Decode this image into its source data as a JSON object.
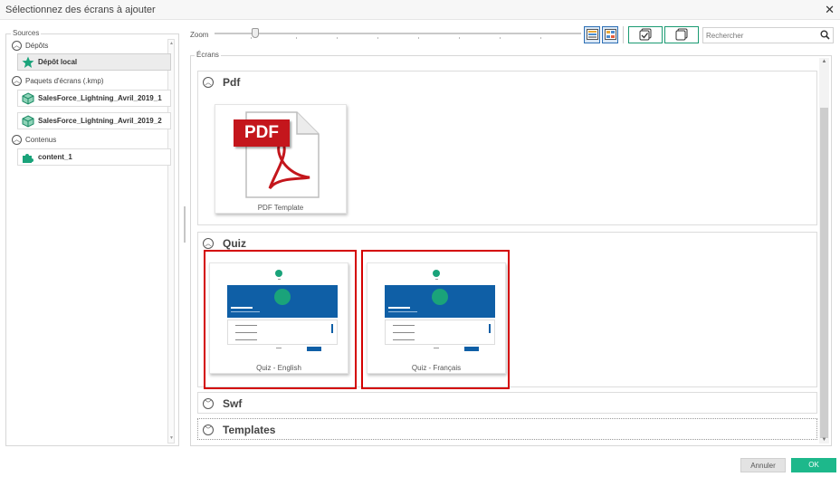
{
  "window": {
    "title": "Sélectionnez des écrans à ajouter",
    "close_icon": "close-icon"
  },
  "sources": {
    "legend": "Sources",
    "groups": [
      {
        "label": "Dépôts",
        "items": [
          {
            "label": "Dépôt local",
            "icon": "star-icon",
            "selected": true
          }
        ]
      },
      {
        "label": "Paquets d'écrans (.kmp)",
        "items": [
          {
            "label": "SalesForce_Lightning_Avril_2019_1",
            "icon": "package-icon"
          },
          {
            "label": "SalesForce_Lightning_Avril_2019_2",
            "icon": "package-icon"
          }
        ]
      },
      {
        "label": "Contenus",
        "items": [
          {
            "label": "content_1",
            "icon": "puzzle-icon"
          }
        ]
      }
    ]
  },
  "toolbar": {
    "zoom_label": "Zoom",
    "zoom_level": 0.11,
    "search_placeholder": "Rechercher"
  },
  "screens": {
    "legend": "Écrans",
    "sections": [
      {
        "name": "Pdf",
        "expanded": true,
        "items": [
          {
            "label": "PDF Template",
            "banner": "PDF"
          }
        ]
      },
      {
        "name": "Quiz",
        "expanded": true,
        "items": [
          {
            "label": "Quiz - English"
          },
          {
            "label": "Quiz - Français"
          }
        ]
      },
      {
        "name": "Swf",
        "expanded": false
      },
      {
        "name": "Templates",
        "expanded": false
      }
    ]
  },
  "footer": {
    "cancel_label": "Annuler",
    "ok_label": "OK"
  },
  "colors": {
    "accent": "#1db88b",
    "highlight": "#d40000",
    "selected_view": "#2d6fb5",
    "pdf_red": "#c4161c"
  }
}
